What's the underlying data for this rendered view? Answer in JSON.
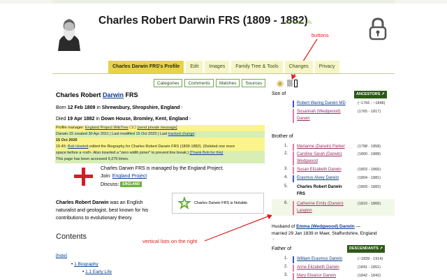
{
  "page": {
    "title": "Charles Robert Darwin FRS (1809 - 1882)",
    "permalink": "ID/LINK/URL"
  },
  "annotations": {
    "buttons": "buttons",
    "lists": "vertical lists on the right"
  },
  "tabs": [
    {
      "label": "Charles Darwin FRS's Profile",
      "active": true
    },
    {
      "label": "Edit"
    },
    {
      "label": "Images"
    },
    {
      "label": "Family Tree & Tools"
    },
    {
      "label": "Changes"
    },
    {
      "label": "Privacy"
    }
  ],
  "subtabs": [
    "Categories",
    "Comments",
    "Matches",
    "Sources"
  ],
  "profile": {
    "name_pre": "Charles Robert ",
    "name_link": "Darwin",
    "name_post": " FRS",
    "born_pre": "Born ",
    "born_date": "12 Feb 1809",
    "born_mid": " in ",
    "born_place": "Shrewsbury, Shropshire, England",
    "died_pre": "Died ",
    "died_date": "19 Apr 1882",
    "died_mid": " in ",
    "died_place": "Down House, Bromley, Kent, England",
    "manager_label": "Profile manager: ",
    "manager_link": "England Project WikiTree",
    "manager_msg": "[send private message]",
    "created": "Darwin-15 created 30 Apr 2011 | Last modified 15 Oct 2020 | Last ",
    "tracked": "tracked change",
    "tracked_post": ":",
    "change_date": "15 Oct 2020",
    "change_time": "15:45: ",
    "change_user": "Bob Howlett",
    "change_text": " edited the Biography for Charles Robert Darwin FRS (1809-1882). (Deleted one more",
    "change_text2": "space before a <ref>. Also inserted a \"zero width joiner\" to prevent line break.) ",
    "thank": "[Thank Bob for this]",
    "accessed": "This page has been accessed 9,279 times.",
    "project_text": "Charles Darwin FRS is managed by the England Project.",
    "join_label": "Join: ",
    "join_link": "England Project",
    "discuss_label": "Discuss: ",
    "discuss_badge": "ENGLAND",
    "notable_text": "Charles Darwin FRS is Notable.",
    "bio1_name": "Charles Robert Darwin",
    "bio1_rest": " was an English",
    "bio2": "naturalist and geologist, best known for his",
    "bio3": "contributions to evolutionary theory.",
    "contents_title": "Contents",
    "hide": "[hide]",
    "toc1": "1 Biography",
    "toc2": "1.1 Early Life"
  },
  "right": {
    "son_of": "Son of",
    "ancestors": "ANCESTORS",
    "parents": [
      {
        "name": "Robert Waring Darwin MD",
        "dates": "(~1766 - ~1848)",
        "color": "#3355cc"
      },
      {
        "name": "Susannah (Wedgwood)",
        "name2": "Darwin",
        "dates": "(1765 - 1817)",
        "color": "#e07aa8"
      }
    ],
    "brother_of": "Brother of",
    "siblings": [
      {
        "n": "1.",
        "name": "Marianne (Darwin) Parker",
        "dates": "(1798 - 1858)",
        "color": "#e07aa8"
      },
      {
        "n": "2.",
        "name": "Caroline Sarah (Darwin)",
        "name2": "Wedgwood",
        "dates": "(1800 - 1888)",
        "color": "#e07aa8"
      },
      {
        "n": "3.",
        "name": "Susan Elizabeth Darwin",
        "dates": "(1803 - 1866)",
        "color": "#e07aa8"
      },
      {
        "n": "4.",
        "name": "Erasmus Alvey Darwin",
        "dates": "(1804 - 1881)",
        "color": "#3355cc"
      },
      {
        "n": "5.",
        "name": "Charles Robert Darwin",
        "name2": "FRS",
        "dates": "(1809 - 1882)",
        "color": "",
        "self": true
      },
      {
        "n": "6.",
        "name": "Catherine Emily (Darwin)",
        "name2": "Langton",
        "dates": "(1810 - 1866)",
        "color": "#e07aa8"
      }
    ],
    "husband_pre": "Husband of ",
    "husband_link": "Emma (Wedgwood) Darwin",
    "husband_post": " —",
    "married": "married 29 Jan 1839 in Maer, Staffordshire, England",
    "father_of": "Father of",
    "descendants": "DESCENDANTS",
    "children": [
      {
        "n": "1.",
        "name": "William Erasmus Darwin",
        "dates": "(~1839 - 1914)",
        "color": "#3355cc"
      },
      {
        "n": "2.",
        "name": "Anne Elizabeth Darwin",
        "dates": "(1841 - 1851)",
        "color": "#e07aa8"
      },
      {
        "n": "3.",
        "name": "Mary Eleanor Darwin",
        "dates": "(1842 - 1842)",
        "color": "#e07aa8"
      }
    ]
  }
}
